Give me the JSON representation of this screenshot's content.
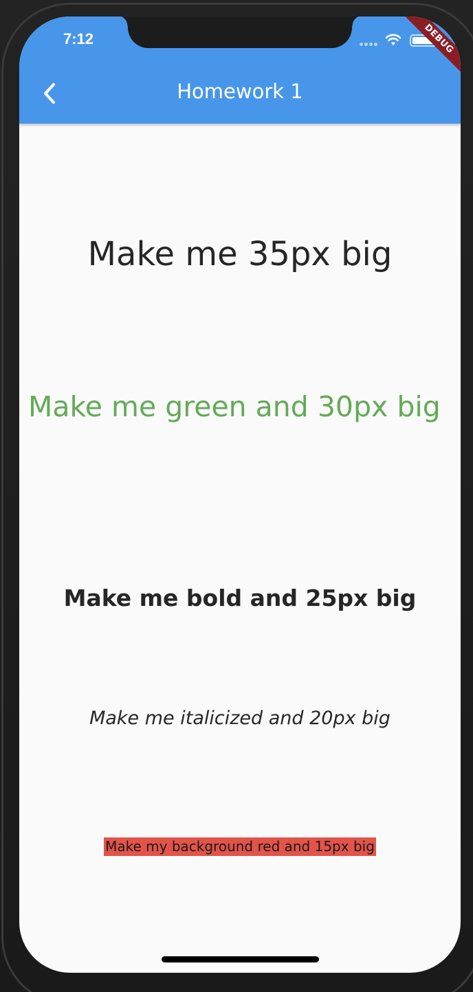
{
  "status_bar": {
    "time": "7:12"
  },
  "debug_banner": "DEBUG",
  "appbar": {
    "title": "Homework 1",
    "back_icon": "chevron-left-icon",
    "color": "#4796ea"
  },
  "texts": {
    "t35": "Make me 35px big",
    "green30": "Make me green and 30px big",
    "bold25": "Make me bold and 25px big",
    "italic20": "Make me italicized and 20px big",
    "red15": "Make my background red and 15px big"
  },
  "colors": {
    "green": "#63aa57",
    "red_bg": "#e2544a",
    "text": "#262626",
    "background": "#fafafa"
  }
}
